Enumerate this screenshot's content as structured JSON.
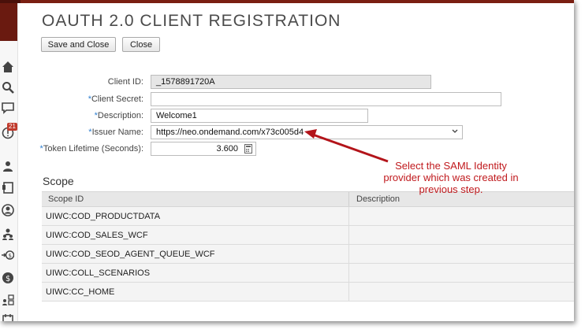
{
  "page": {
    "title": "OAUTH 2.0 CLIENT REGISTRATION"
  },
  "toolbar": {
    "save_close_label": "Save and Close",
    "close_label": "Close"
  },
  "form": {
    "client_id": {
      "label": "Client ID:",
      "value": "_1578891720A",
      "required": false
    },
    "client_secret": {
      "label": "Client Secret:",
      "value": "",
      "required": true
    },
    "description": {
      "label": "Description:",
      "value": "Welcome1",
      "required": true
    },
    "issuer_name": {
      "label": "Issuer Name:",
      "value": "https://neo.ondemand.com/x73c005d4",
      "required": true
    },
    "token_lifetime": {
      "label": "Token Lifetime (Seconds):",
      "value": "3.600",
      "required": true
    }
  },
  "required_mark": "*",
  "scope": {
    "title": "Scope",
    "columns": [
      "Scope ID",
      "Description"
    ],
    "rows": [
      {
        "id": "UIWC:COD_PRODUCTDATA",
        "description": ""
      },
      {
        "id": "UIWC:COD_SALES_WCF",
        "description": ""
      },
      {
        "id": "UIWC:COD_SEOD_AGENT_QUEUE_WCF",
        "description": ""
      },
      {
        "id": "UIWC:COLL_SCENARIOS",
        "description": ""
      },
      {
        "id": "UIWC:CC_HOME",
        "description": ""
      }
    ]
  },
  "sidebar": {
    "notification_count": "21",
    "icons": [
      "home-icon",
      "search-icon",
      "chat-icon",
      "alert-icon",
      "person-icon",
      "document-icon",
      "account-icon",
      "team-icon",
      "money-transfer-icon",
      "dollar-icon",
      "org-icon",
      "calendar-icon"
    ]
  },
  "annotation": {
    "text": "Select the SAML Identity provider which was created in previous step.",
    "color": "#c0191d"
  }
}
